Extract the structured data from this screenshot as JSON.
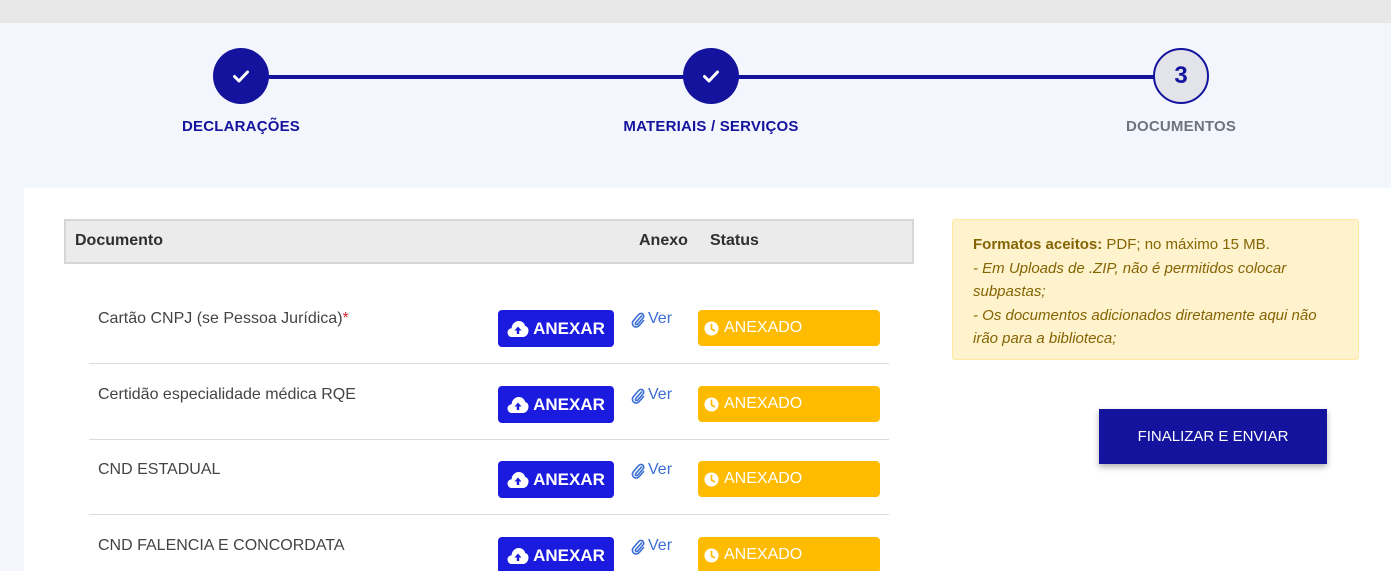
{
  "stepper": {
    "steps": [
      {
        "label": "DECLARAÇÕES",
        "state": "done"
      },
      {
        "label": "MATERIAIS / SERVIÇOS",
        "state": "done"
      },
      {
        "label": "DOCUMENTOS",
        "state": "current",
        "number": "3"
      }
    ],
    "accent_color": "#13139e"
  },
  "table": {
    "headers": {
      "documento": "Documento",
      "anexo": "Anexo",
      "status": "Status"
    },
    "rows": [
      {
        "name": "Cartão CNPJ (se Pessoa Jurídica)",
        "required_mark": "*",
        "attach_label": "ANEXAR",
        "view_label": "Ver",
        "status": "ANEXADO"
      },
      {
        "name": "Certidão especialidade médica RQE",
        "required_mark": "",
        "attach_label": "ANEXAR",
        "view_label": "Ver",
        "status": "ANEXADO"
      },
      {
        "name": "CND ESTADUAL",
        "required_mark": "",
        "attach_label": "ANEXAR",
        "view_label": "Ver",
        "status": "ANEXADO"
      },
      {
        "name": "CND FALENCIA E CONCORDATA",
        "required_mark": "",
        "attach_label": "ANEXAR",
        "view_label": "Ver",
        "status": "ANEXADO"
      }
    ]
  },
  "info": {
    "title": "Formatos aceitos:",
    "formats": " PDF; no máximo 15 MB.",
    "line1": "- Em Uploads de .ZIP, não é permitidos colocar subpastas;",
    "line2": "- Os documentos adicionados diretamente aqui não irão para a biblioteca;"
  },
  "actions": {
    "finalize_label": "FINALIZAR E ENVIAR"
  },
  "colors": {
    "status_attached": "#ffbb00",
    "attach_button": "#1b1be0",
    "info_bg": "#fff3cd"
  }
}
